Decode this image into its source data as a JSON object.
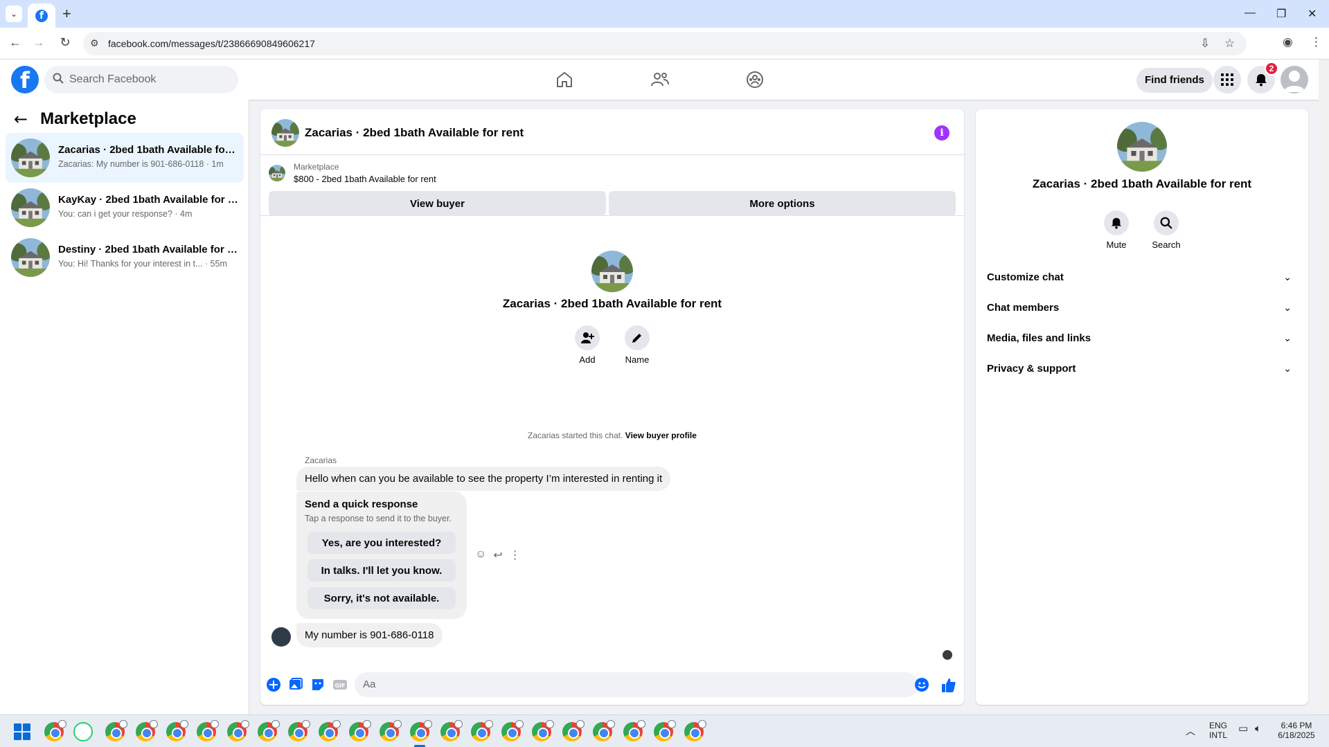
{
  "browser": {
    "url": "facebook.com/messages/t/23866690849606217",
    "tab_icon": "facebook-icon"
  },
  "topbar": {
    "search_placeholder": "Search Facebook",
    "find_friends": "Find friends",
    "notification_count": "2"
  },
  "sidebar": {
    "title": "Marketplace",
    "conversations": [
      {
        "title": "Zacarias · 2bed 1bath Available for rent",
        "preview": "Zacarias: My number is 901-686-0118 · 1m",
        "active": true
      },
      {
        "title": "KayKay · 2bed 1bath Available for rent",
        "preview": "You: can i get your response? · 4m",
        "active": false
      },
      {
        "title": "Destiny · 2bed 1bath Available for rent",
        "preview": "You: Hi! Thanks for your interest in t... · 55m",
        "active": false
      }
    ]
  },
  "chat": {
    "title": "Zacarias · 2bed 1bath Available for rent",
    "marketplace_label": "Marketplace",
    "marketplace_item": "$800 - 2bed 1bath Available for rent",
    "view_buyer": "View buyer",
    "more_options": "More options",
    "intro_title": "Zacarias · 2bed 1bath Available for rent",
    "intro_add": "Add",
    "intro_name": "Name",
    "started_text": "Zacarias started this chat.",
    "view_buyer_profile": "View buyer profile",
    "sender_name": "Zacarias",
    "message_1": "Hello when can you be available to see the property I’m interested in renting it",
    "quick_title": "Send a quick response",
    "quick_subtitle": "Tap a response to send it to the buyer.",
    "quick_options": [
      "Yes, are you interested?",
      "In talks. I'll let you know.",
      "Sorry, it's not available."
    ],
    "message_2": "My number is 901-686-0118",
    "composer_placeholder": "Aa"
  },
  "details": {
    "title": "Zacarias · 2bed 1bath Available for rent",
    "mute": "Mute",
    "search": "Search",
    "sections": [
      "Customize chat",
      "Chat members",
      "Media, files and links",
      "Privacy & support"
    ]
  },
  "taskbar": {
    "lang_1": "ENG",
    "lang_2": "INTL",
    "time": "6:46 PM",
    "date": "6/18/2025"
  },
  "colors": {
    "fb_blue": "#1877f2",
    "active_conv": "#ebf5ff",
    "info_purple": "#a033ff",
    "badge_red": "#e41e3f"
  }
}
